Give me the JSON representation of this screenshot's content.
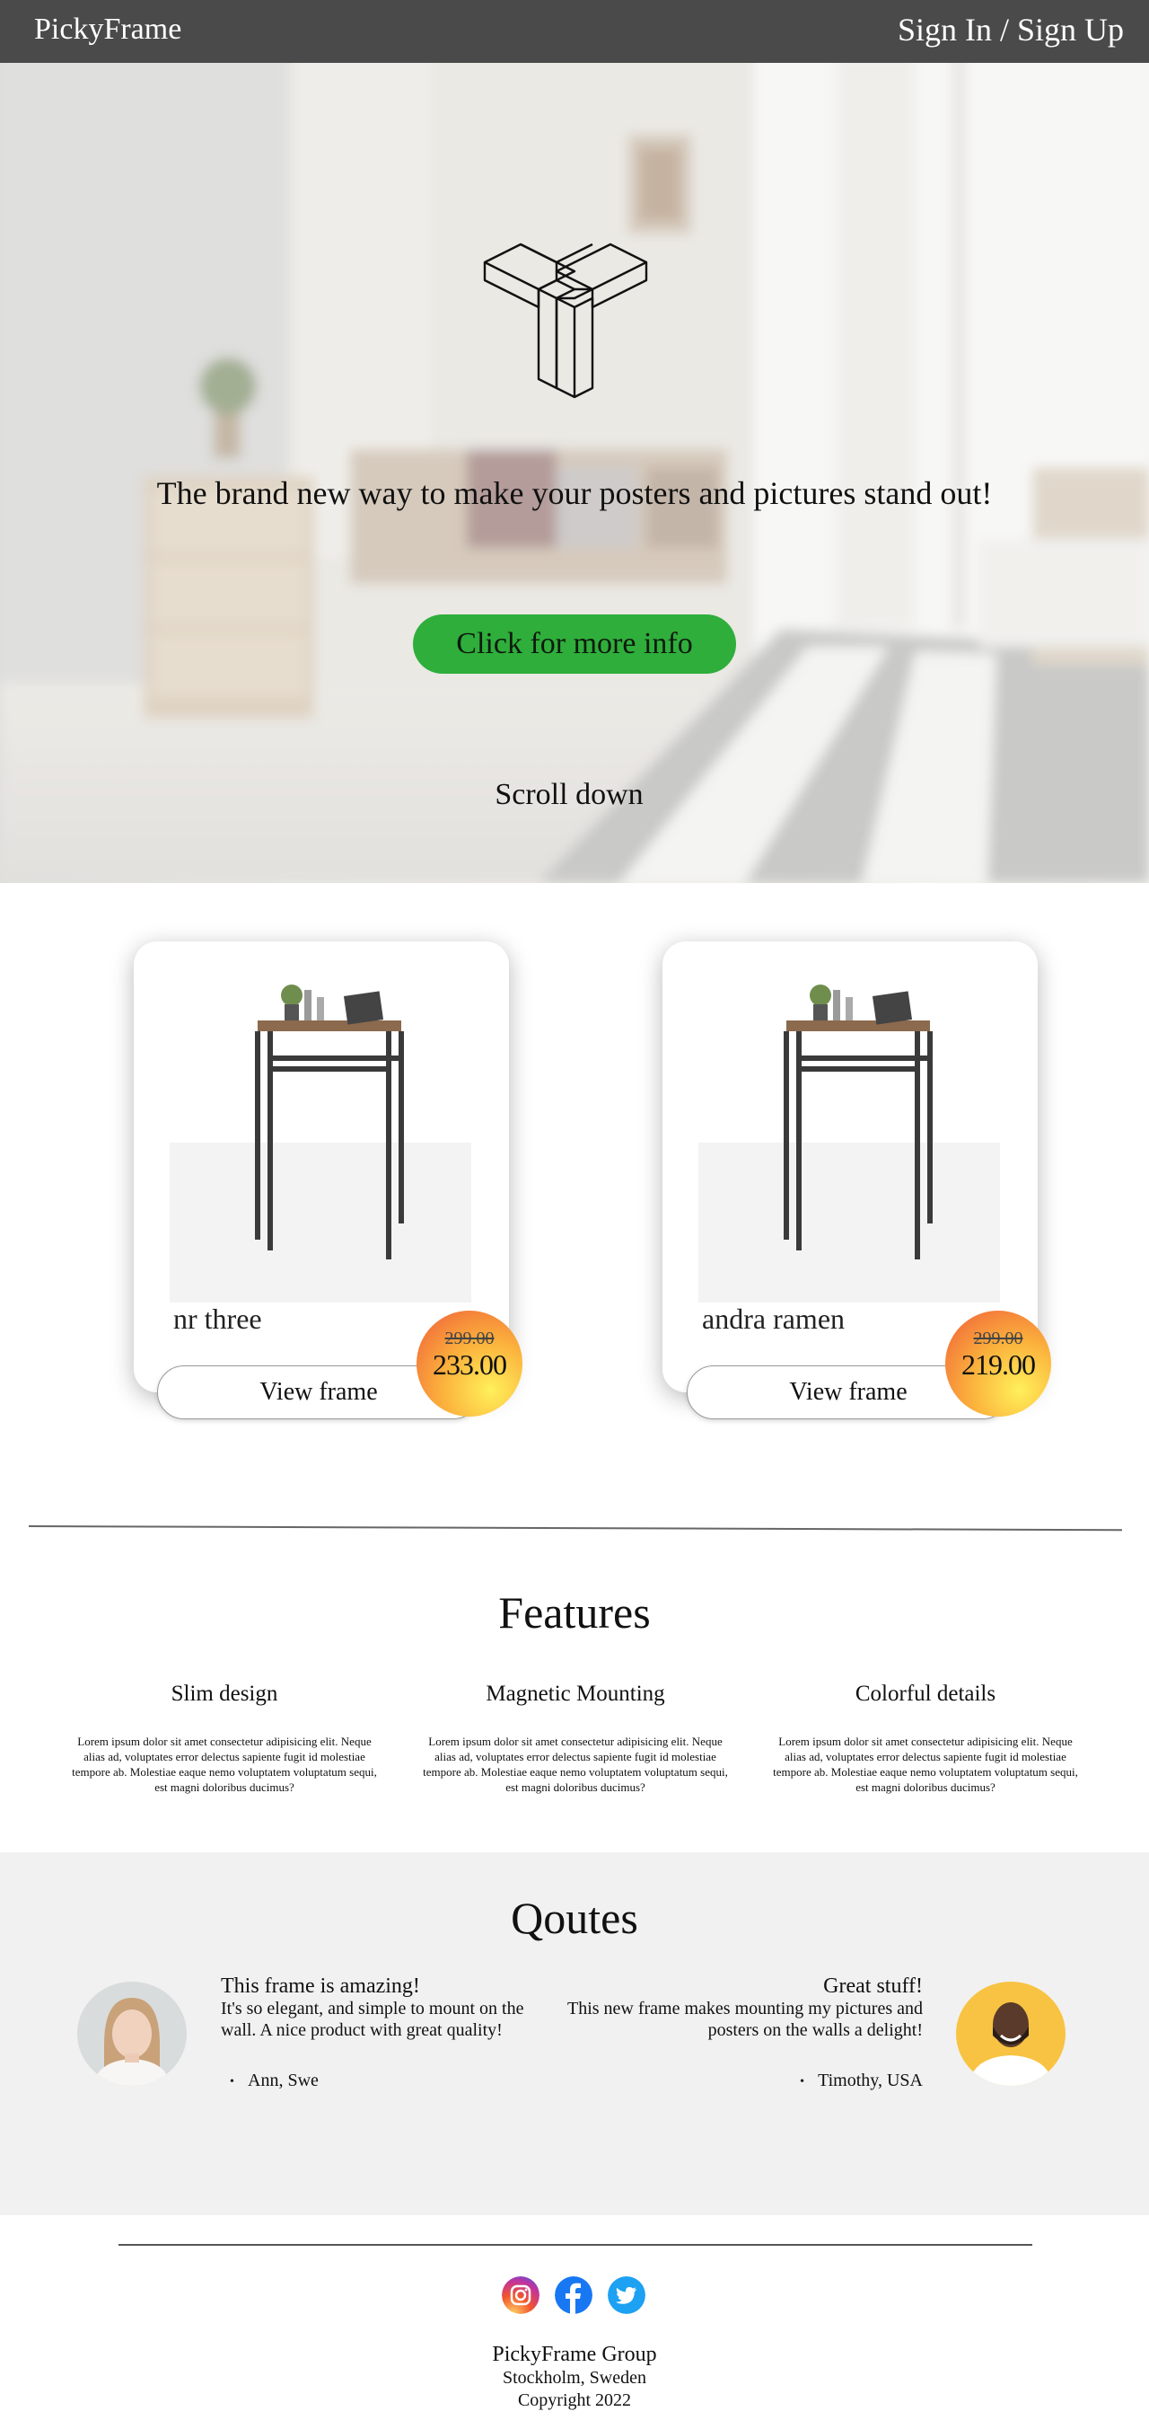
{
  "nav": {
    "brand": "PickyFrame",
    "auth": "Sign In / Sign Up"
  },
  "hero": {
    "tagline": "The brand new way to make your posters and pictures stand out!",
    "cta": "Click for more info",
    "scroll": "Scroll down",
    "cta_color": "#2fae3b"
  },
  "products": [
    {
      "name": "nr three",
      "old_price": "299.00",
      "price": "233.00",
      "button": "View frame"
    },
    {
      "name": "andra ramen",
      "old_price": "299.00",
      "price": "219.00",
      "button": "View frame"
    }
  ],
  "features": {
    "title": "Features",
    "items": [
      {
        "title": "Slim design",
        "text": "Lorem ipsum dolor sit amet consectetur adipisicing elit. Neque alias ad, voluptates error delectus sapiente fugit id molestiae tempore ab. Molestiae eaque nemo voluptatem voluptatum sequi, est magni doloribus ducimus?"
      },
      {
        "title": "Magnetic Mounting",
        "text": "Lorem ipsum dolor sit amet consectetur adipisicing elit. Neque alias ad, voluptates error delectus sapiente fugit id molestiae tempore ab. Molestiae eaque nemo voluptatem voluptatum sequi, est magni doloribus ducimus?"
      },
      {
        "title": "Colorful details",
        "text": "Lorem ipsum dolor sit amet consectetur adipisicing elit. Neque alias ad, voluptates error delectus sapiente fugit id molestiae tempore ab. Molestiae eaque nemo voluptatem voluptatum sequi, est magni doloribus ducimus?"
      }
    ]
  },
  "quotes": {
    "title": "Qoutes",
    "items": [
      {
        "title": "This frame is amazing!",
        "text": "It's so elegant, and simple to mount on the wall. A nice product with great quality!",
        "author": "Ann, Swe"
      },
      {
        "title": "Great stuff!",
        "text": "This new frame makes mounting my pictures and posters on the walls a delight!",
        "author": "Timothy, USA"
      }
    ]
  },
  "footer": {
    "social": [
      "instagram-icon",
      "facebook-icon",
      "twitter-icon"
    ],
    "company": "PickyFrame Group",
    "location": "Stockholm, Sweden",
    "copyright": "Copyright 2022"
  }
}
